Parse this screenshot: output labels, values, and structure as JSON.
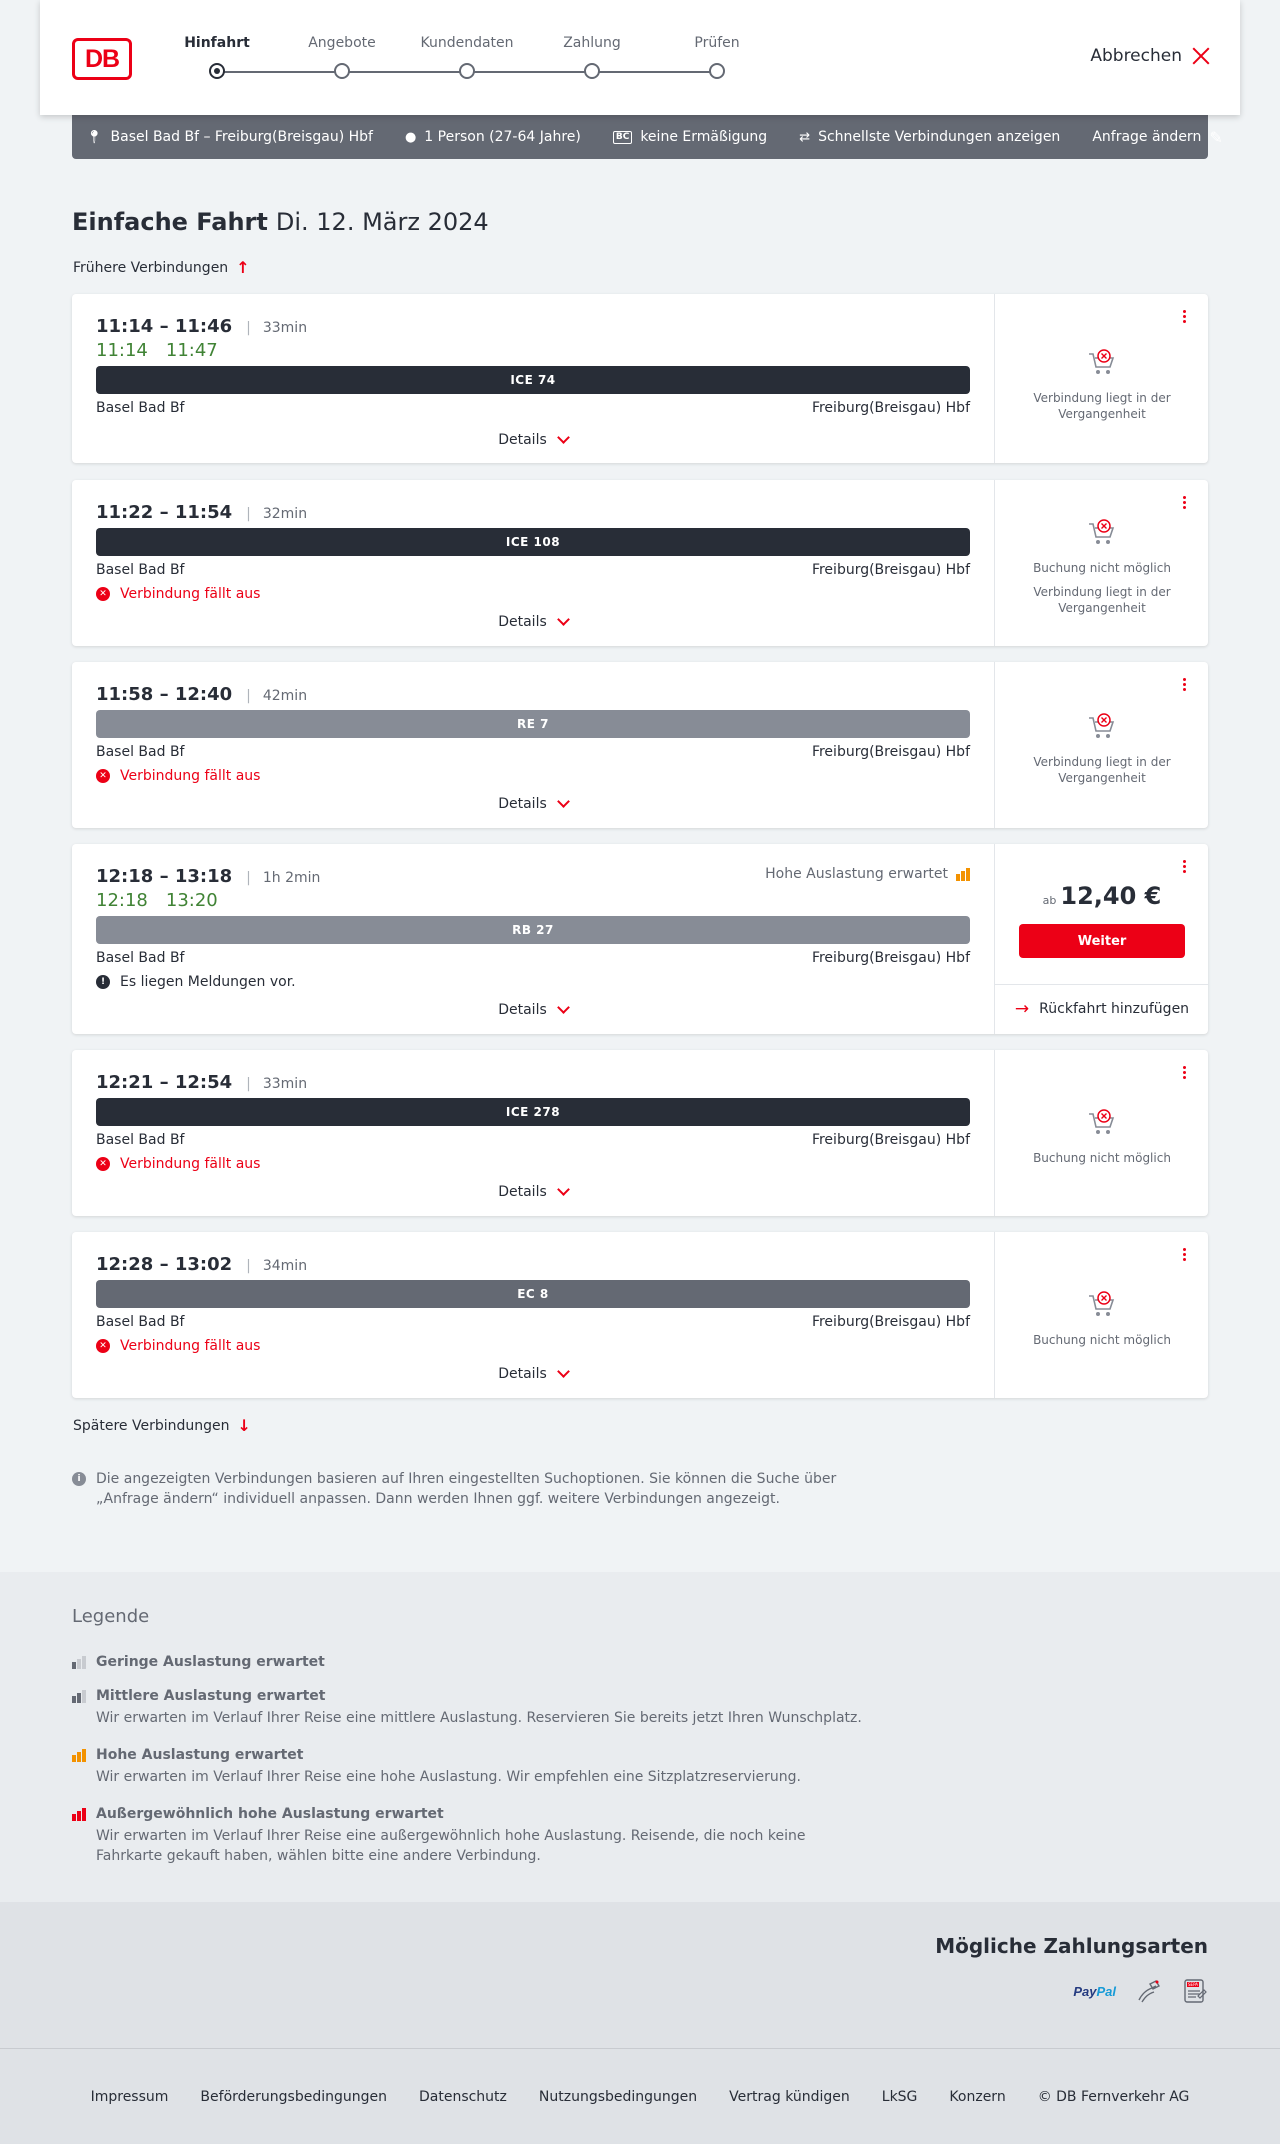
{
  "header": {
    "logo": "DB",
    "steps": [
      {
        "label": "Hinfahrt",
        "active": true
      },
      {
        "label": "Angebote",
        "active": false
      },
      {
        "label": "Kundendaten",
        "active": false
      },
      {
        "label": "Zahlung",
        "active": false
      },
      {
        "label": "Prüfen",
        "active": false
      }
    ],
    "cancel_label": "Abbrechen"
  },
  "searchbar": {
    "route": "Basel Bad Bf – Freiburg(Breisgau) Hbf",
    "passengers": "1 Person (27-64 Jahre)",
    "discount_badge": "BC",
    "discount": "keine Ermäßigung",
    "fastest": "Schnellste Verbindungen anzeigen",
    "edit": "Anfrage ändern"
  },
  "title": {
    "main": "Einfache Fahrt",
    "date": "Di. 12. März 2024"
  },
  "earlier": "Frühere Verbindungen",
  "later": "Spätere Verbindungen",
  "connections": [
    {
      "dep": "11:14",
      "arr": "11:46",
      "duration": "33min",
      "rt_dep": "11:14",
      "rt_arr": "11:47",
      "train": "ICE 74",
      "train_color": "#282d37",
      "from": "Basel Bad Bf",
      "to": "Freiburg(Breisgau) Hbf",
      "details": "Details",
      "right_messages": [
        "Verbindung liegt in der Vergangenheit"
      ]
    },
    {
      "dep": "11:22",
      "arr": "11:54",
      "duration": "32min",
      "train": "ICE 108",
      "train_color": "#282d37",
      "from": "Basel Bad Bf",
      "to": "Freiburg(Breisgau) Hbf",
      "status": "Verbindung fällt aus",
      "details": "Details",
      "right_messages": [
        "Buchung nicht möglich",
        "Verbindung liegt in der Vergangenheit"
      ]
    },
    {
      "dep": "11:58",
      "arr": "12:40",
      "duration": "42min",
      "train": "RE 7",
      "train_color": "#878c96",
      "from": "Basel Bad Bf",
      "to": "Freiburg(Breisgau) Hbf",
      "status": "Verbindung fällt aus",
      "details": "Details",
      "right_messages": [
        "Verbindung liegt in der Vergangenheit"
      ]
    },
    {
      "dep": "12:18",
      "arr": "13:18",
      "duration": "1h 2min",
      "rt_dep": "12:18",
      "rt_arr": "13:20",
      "load": "Hohe Auslastung erwartet",
      "train": "RB 27",
      "train_color": "#878c96",
      "from": "Basel Bad Bf",
      "to": "Freiburg(Breisgau) Hbf",
      "info": "Es liegen Meldungen vor.",
      "details": "Details",
      "price_prefix": "ab",
      "price": "12,40 €",
      "button": "Weiter",
      "return_link": "Rückfahrt hinzufügen"
    },
    {
      "dep": "12:21",
      "arr": "12:54",
      "duration": "33min",
      "train": "ICE 278",
      "train_color": "#282d37",
      "from": "Basel Bad Bf",
      "to": "Freiburg(Breisgau) Hbf",
      "status": "Verbindung fällt aus",
      "details": "Details",
      "right_messages": [
        "Buchung nicht möglich"
      ]
    },
    {
      "dep": "12:28",
      "arr": "13:02",
      "duration": "34min",
      "train": "EC 8",
      "train_color": "#646973",
      "from": "Basel Bad Bf",
      "to": "Freiburg(Breisgau) Hbf",
      "status": "Verbindung fällt aus",
      "details": "Details",
      "right_messages": [
        "Buchung nicht möglich"
      ]
    }
  ],
  "note": "Die angezeigten Verbindungen basieren auf Ihren eingestellten Suchoptionen. Sie können die Suche über „Anfrage ändern“ individuell anpassen. Dann werden Ihnen ggf. weitere Verbindungen angezeigt.",
  "legend": {
    "title": "Legende",
    "items": [
      {
        "title": "Geringe Auslastung erwartet",
        "desc": "",
        "level": 1,
        "color": "#646973"
      },
      {
        "title": "Mittlere Auslastung erwartet",
        "desc": "Wir erwarten im Verlauf Ihrer Reise eine mittlere Auslastung. Reservieren Sie bereits jetzt Ihren Wunschplatz.",
        "level": 2,
        "color": "#646973"
      },
      {
        "title": "Hohe Auslastung erwartet",
        "desc": "Wir erwarten im Verlauf Ihrer Reise eine hohe Auslastung. Wir empfehlen eine Sitzplatzreservierung.",
        "level": 3,
        "color": "#f39200"
      },
      {
        "title": "Außergewöhnlich hohe Auslastung erwartet",
        "desc": "Wir erwarten im Verlauf Ihrer Reise eine außergewöhnlich hohe Auslastung. Reisende, die noch keine Fahrkarte gekauft haben, wählen bitte eine andere Verbindung.",
        "level": 4,
        "color": "#ec0016"
      }
    ]
  },
  "payment": {
    "title": "Mögliche Zahlungsarten",
    "paypal_1": "Pay",
    "paypal_2": "Pal",
    "sepa": "SEPA"
  },
  "footer": [
    "Impressum",
    "Beförderungsbedingungen",
    "Datenschutz",
    "Nutzungsbedingungen",
    "Vertrag kündigen",
    "LkSG",
    "Konzern",
    "© DB Fernverkehr AG"
  ],
  "colors": {
    "accent": "#ec0016",
    "realtime": "#408335",
    "bar_dark": "#282d37",
    "bar_grey": "#878c96"
  }
}
